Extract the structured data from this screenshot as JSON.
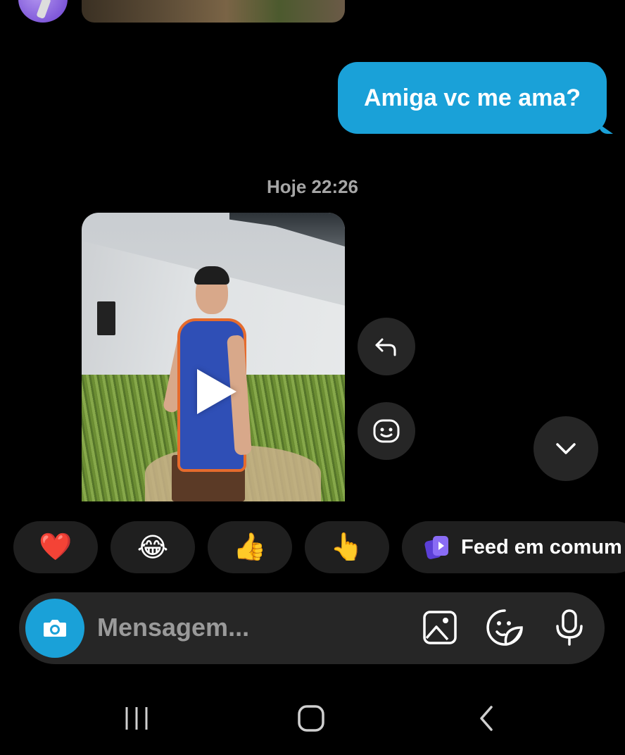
{
  "thread": {
    "sent_message": "Amiga vc me ama?",
    "timestamp": "Hoje 22:26"
  },
  "reactions": {
    "quick": [
      "❤️",
      "😂",
      "👍",
      "👆"
    ],
    "feed_label": "Feed em comum"
  },
  "composer": {
    "placeholder": "Mensagem..."
  },
  "colors": {
    "accent": "#1aa1d8",
    "bubble_bg": "#262626",
    "chip_bg": "#1f1f1f",
    "feed_icon": "#7b5cf0"
  },
  "icons": {
    "reply": "reply-arrow-icon",
    "react": "smiley-icon",
    "scroll_down": "chevron-down-icon",
    "camera": "camera-icon",
    "gallery": "image-icon",
    "sticker": "sticker-icon",
    "mic": "microphone-icon",
    "play": "play-icon",
    "feed": "feed-stack-icon"
  }
}
